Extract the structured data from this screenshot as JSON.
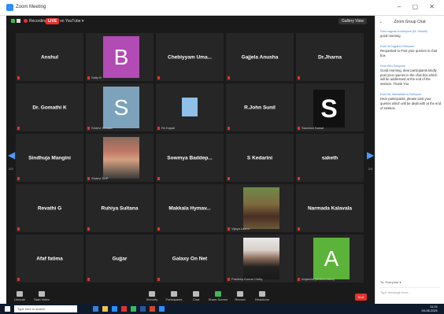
{
  "window": {
    "title": "Zoom Meeting"
  },
  "topstrip": {
    "recording": "Recording",
    "live": "LIVE",
    "live_state": "on YouTube ▾",
    "gallery_view": "Gallery View"
  },
  "navigation": {
    "left_page": "2/3",
    "right_page": "2/3"
  },
  "tiles": [
    {
      "name": "Anshul",
      "small_name": ""
    },
    {
      "name": "",
      "small_name": "Satty B",
      "avatar_letter": "B"
    },
    {
      "name": "Chebiyyam  Uma...",
      "small_name": ""
    },
    {
      "name": "Gajjela Anusha",
      "small_name": ""
    },
    {
      "name": "Dr.Jharna",
      "small_name": ""
    },
    {
      "name": "Dr. Gomathi K",
      "small_name": ""
    },
    {
      "name": "",
      "small_name": "Sridevi Sirisala",
      "avatar_letter": "S"
    },
    {
      "name": "",
      "small_name": "Rk Kapali"
    },
    {
      "name": "R.John Sunil",
      "small_name": ""
    },
    {
      "name": "",
      "small_name": "Sanchari Samal",
      "avatar_letter": "S"
    },
    {
      "name": "Sindhuja Mangini",
      "small_name": ""
    },
    {
      "name": "",
      "small_name": "Sridevi SHP"
    },
    {
      "name": "Sowmya  Baddep...",
      "small_name": ""
    },
    {
      "name": "S Kedarini",
      "small_name": ""
    },
    {
      "name": "saketh",
      "small_name": ""
    },
    {
      "name": "Revathi G",
      "small_name": ""
    },
    {
      "name": "Ruhiya Sultana",
      "small_name": ""
    },
    {
      "name": "Makkala  Hymav...",
      "small_name": ""
    },
    {
      "name": "",
      "small_name": "Vijaya Laxmi"
    },
    {
      "name": "Narmada Kalavala",
      "small_name": ""
    },
    {
      "name": "Afaf fatima",
      "small_name": ""
    },
    {
      "name": "Gujjar",
      "small_name": ""
    },
    {
      "name": "Galaxy On Net",
      "small_name": ""
    },
    {
      "name": "",
      "small_name": "Pradeep Kumar Chitty"
    },
    {
      "name": "",
      "small_name": "Anjanela (Mathematics)",
      "avatar_letter": "A"
    }
  ],
  "toolbar": {
    "items": [
      "Unmute",
      "Start Video",
      "Security",
      "Participants",
      "Chat",
      "Share Screen",
      "Record",
      "Reactions"
    ],
    "participants_count": "44",
    "end": "End"
  },
  "chat": {
    "title": "Zoom Group Chat",
    "messages": [
      {
        "from": "From saguna to everyone (Dr. Shruthi)",
        "text": "good morning"
      },
      {
        "from": "From Sri Ugyal to Everyone",
        "text": "Requested to Post your queries in chat box"
      },
      {
        "from": "From Rk's Everyone",
        "text": "Good morning, dear participants kindly post your queries in the chat box which will be addressed at the end of the session. Thank You"
      },
      {
        "from": "From Mr. Saimahesh to Everyone",
        "text": "Dear participants, please post your queries which will be dealt with at the end of session"
      }
    ],
    "to_label": "To: Everyone ▾",
    "input_placeholder": "Type message here..."
  },
  "taskbar": {
    "search_placeholder": "Type here to search",
    "time": "11:21",
    "date": "04-06-2021"
  },
  "colors": {
    "live_red": "#e5322d",
    "zoom_blue": "#2d8cff",
    "purple_avatar": "#b24bb4",
    "green_avatar": "#5cb339"
  }
}
